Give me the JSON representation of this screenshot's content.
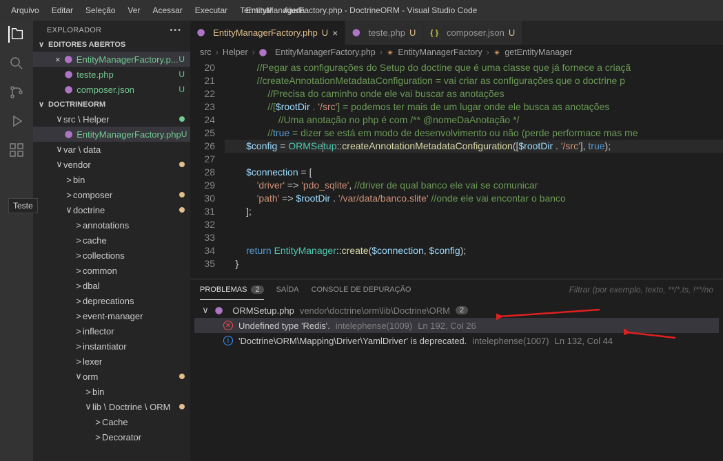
{
  "window": {
    "title": "EntityManagerFactory.php - DoctrineORM - Visual Studio Code"
  },
  "menu": [
    "Arquivo",
    "Editar",
    "Seleção",
    "Ver",
    "Acessar",
    "Executar",
    "Terminal",
    "Ajuda"
  ],
  "tooltip": "Teste",
  "sidebar": {
    "title": "EXPLORADOR",
    "openEditorsHdr": "EDITORES ABERTOS",
    "openEditors": [
      {
        "name": "EntityManagerFactory.p...",
        "badge": "U",
        "cls": "git-u",
        "active": true
      },
      {
        "name": "teste.php",
        "badge": "U",
        "cls": "git-u"
      },
      {
        "name": "composer.json",
        "badge": "U",
        "cls": "git-u"
      }
    ],
    "projectHdr": "DOCTRINEORM",
    "tree": [
      {
        "l": "src \\ Helper",
        "i": 2,
        "chev": "∨",
        "dot": "u"
      },
      {
        "l": "EntityManagerFactory.php",
        "i": 3,
        "php": true,
        "badge": "U",
        "cls": "git-u",
        "sel": true
      },
      {
        "l": "var \\ data",
        "i": 2,
        "chev": "∨",
        "dim": true
      },
      {
        "l": "vendor",
        "i": 2,
        "chev": "∨",
        "dim": true,
        "dot": "m"
      },
      {
        "l": "bin",
        "i": 3,
        "chev": ">",
        "dim": true
      },
      {
        "l": "composer",
        "i": 3,
        "chev": ">",
        "dim": true,
        "dot": "m"
      },
      {
        "l": "doctrine",
        "i": 3,
        "chev": "∨",
        "dim": true,
        "dot": "m"
      },
      {
        "l": "annotations",
        "i": 4,
        "chev": ">",
        "dim": true
      },
      {
        "l": "cache",
        "i": 4,
        "chev": ">",
        "dim": true
      },
      {
        "l": "collections",
        "i": 4,
        "chev": ">",
        "dim": true
      },
      {
        "l": "common",
        "i": 4,
        "chev": ">",
        "dim": true
      },
      {
        "l": "dbal",
        "i": 4,
        "chev": ">",
        "dim": true
      },
      {
        "l": "deprecations",
        "i": 4,
        "chev": ">",
        "dim": true
      },
      {
        "l": "event-manager",
        "i": 4,
        "chev": ">",
        "dim": true
      },
      {
        "l": "inflector",
        "i": 4,
        "chev": ">",
        "dim": true
      },
      {
        "l": "instantiator",
        "i": 4,
        "chev": ">",
        "dim": true
      },
      {
        "l": "lexer",
        "i": 4,
        "chev": ">",
        "dim": true
      },
      {
        "l": "orm",
        "i": 4,
        "chev": "∨",
        "dim": true,
        "dot": "m"
      },
      {
        "l": "bin",
        "i": 5,
        "chev": ">",
        "dim": true
      },
      {
        "l": "lib \\ Doctrine \\ ORM",
        "i": 5,
        "chev": "∨",
        "dim": true,
        "dot": "m"
      },
      {
        "l": "Cache",
        "i": 6,
        "chev": ">",
        "dim": true
      },
      {
        "l": "Decorator",
        "i": 6,
        "chev": ">",
        "dim": true
      }
    ]
  },
  "tabs": [
    {
      "label": "EntityManagerFactory.php",
      "mod": "U",
      "active": true,
      "php": true,
      "close": true
    },
    {
      "label": "teste.php",
      "mod": "U",
      "php": true
    },
    {
      "label": "composer.json",
      "mod": "U",
      "json": true
    }
  ],
  "breadcrumb": [
    "src",
    "Helper",
    "EntityManagerFactory.php",
    "EntityManagerFactory",
    "getEntityManager"
  ],
  "code": {
    "start": 20,
    "lines": [
      "            //Pegar as configurações do Setup do doctine que é uma classe que já fornece a criaçã",
      "            //createAnnotationMetadataConfiguration = vai criar as configurações que o doctrine p",
      "                //Precisa do caminho onde ele vai buscar as anotações",
      "                //[$rootDir . '/src'] = podemos ter mais de um lugar onde ele busca as anotações ",
      "                    //Uma anotação no php é com /** @nomeDaAnotação */",
      "                //true = dizer se está em modo de desenvolvimento ou não (perde performace mas me",
      "        $config = ORMSe|tup::createAnnotationMetadataConfiguration([$rootDir . '/src'], true);",
      "",
      "        $connection = [",
      "            'driver' => 'pdo_sqlite', //driver de qual banco ele vai se comunicar",
      "            'path' => $rootDir . '/var/data/banco.slite' //onde ele vai encontar o banco",
      "        ];",
      "",
      "",
      "        return EntityManager::create($connection, $config);",
      "    }"
    ]
  },
  "panel": {
    "tabs": {
      "problems": "PROBLEMAS",
      "output": "SAÍDA",
      "debug": "CONSOLE DE DEPURAÇÃO"
    },
    "count": "2",
    "filterPlaceholder": "Filtrar (por exemplo, texto, **/*.ts, !**/no",
    "file": {
      "name": "ORMSetup.php",
      "path": "vendor\\doctrine\\orm\\lib\\Doctrine\\ORM",
      "count": "2"
    },
    "items": [
      {
        "type": "err",
        "msg": "Undefined type 'Redis'.",
        "src": "intelephense(1009)",
        "loc": "Ln 192, Col 26",
        "sel": true
      },
      {
        "type": "info",
        "msg": "'Doctrine\\ORM\\Mapping\\Driver\\YamlDriver' is deprecated.",
        "src": "intelephense(1007)",
        "loc": "Ln 132, Col 44"
      }
    ]
  }
}
